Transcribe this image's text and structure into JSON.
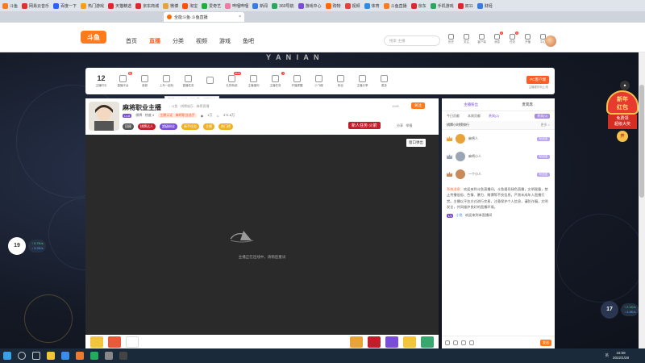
{
  "browser": {
    "bookmarks": [
      {
        "label": "斗鱼",
        "color": "#ff7a1a"
      },
      {
        "label": "网易云音乐",
        "color": "#e03030"
      },
      {
        "label": "百度一下",
        "color": "#2a62ff"
      },
      {
        "label": "热门游戏",
        "color": "#ff9a1a"
      },
      {
        "label": "天猫精选",
        "color": "#e0262e"
      },
      {
        "label": "京东商城",
        "color": "#e0262e"
      },
      {
        "label": "微博",
        "color": "#e8a23a"
      },
      {
        "label": "淘宝",
        "color": "#ff5000"
      },
      {
        "label": "爱奇艺",
        "color": "#1ab33a"
      },
      {
        "label": "哔哩哔哩",
        "color": "#f479a2"
      },
      {
        "label": "新闻",
        "color": "#3a7ae8"
      },
      {
        "label": "360导航",
        "color": "#26a85e"
      },
      {
        "label": "游戏中心",
        "color": "#7a4dd8"
      },
      {
        "label": "购物",
        "color": "#ff6a00"
      },
      {
        "label": "视频",
        "color": "#e8403a"
      },
      {
        "label": "体育",
        "color": "#2a8de8"
      },
      {
        "label": "斗鱼直播",
        "color": "#ff7a1a"
      },
      {
        "label": "京东",
        "color": "#e0262e"
      },
      {
        "label": "手机游戏",
        "color": "#26a85e"
      },
      {
        "label": "双11",
        "color": "#e0262e"
      },
      {
        "label": "财经",
        "color": "#3a7ae8"
      }
    ],
    "active_tab_title": "全能斗鱼·斗鱼直播",
    "url_hint": "https://www.douyu.com"
  },
  "nav": {
    "logo": "斗鱼",
    "links": [
      "首页",
      "直播",
      "分类",
      "视频",
      "游戏",
      "鱼吧"
    ],
    "active_link": "直播",
    "search_placeholder": "搜索·主播",
    "icons": [
      {
        "name": "history-icon",
        "label": "历史",
        "badge": ""
      },
      {
        "name": "follow-icon",
        "label": "关注",
        "badge": ""
      },
      {
        "name": "client-icon",
        "label": "客户端",
        "badge": ""
      },
      {
        "name": "message-icon",
        "label": "消息",
        "badge": "2"
      },
      {
        "name": "task-icon",
        "label": "任务",
        "badge": "1"
      },
      {
        "name": "live-icon",
        "label": "开播",
        "badge": ""
      },
      {
        "name": "center-icon",
        "label": "中心",
        "badge": ""
      }
    ]
  },
  "banner_text": "Y A N I A N",
  "catbar": {
    "count": "12",
    "count_label": "主播时长",
    "items": [
      {
        "label": "直播平台",
        "hot": "热"
      },
      {
        "label": "音频",
        "hot": ""
      },
      {
        "label": "上车一起玩",
        "hot": ""
      },
      {
        "label": "直播任务",
        "hot": ""
      },
      {
        "label": "",
        "hot": ""
      },
      {
        "label": "礼物系统",
        "hot": "NEW"
      },
      {
        "label": "主播福利",
        "hot": ""
      },
      {
        "label": "主播任务",
        "hot": "1"
      },
      {
        "label": "开播提醒",
        "hot": ""
      },
      {
        "label": "小飞碟",
        "hot": ""
      },
      {
        "label": "粉丝",
        "hot": ""
      },
      {
        "label": "主播分享",
        "hot": ""
      },
      {
        "label": "更多",
        "hot": ""
      }
    ],
    "pc_button": "PC客户端",
    "pc_sub": "主播更好玩上线",
    "tooltip": "不想上车出错 · 带大家一起玩游戏"
  },
  "room": {
    "title": "麻将职业主播",
    "meta": "· 斗鱼 · 棋牌娱乐 · 麻将直播",
    "room_id": "1108",
    "follow": "关注",
    "level": "Lv.8",
    "level_text": "棋牌 · 热度 4",
    "tag": "主播认证 · 麻将职业选手",
    "viewers": "1万",
    "hot": "371.6万",
    "pills": [
      {
        "label": "回顾",
        "color": "#555"
      },
      {
        "label": "棋牌达人",
        "color": "#c21d2b"
      },
      {
        "label": "超级粉丝",
        "color": "#7a4dd8"
      },
      {
        "label": "新手任务",
        "color": "#f0b020"
      },
      {
        "label": "主播",
        "color": "#f0b020"
      },
      {
        "label": "热门榜",
        "color": "#f0b020"
      }
    ],
    "new_task": "新人任务·火箭",
    "share": "分享",
    "report": "举报"
  },
  "player": {
    "fullscreen": "窗口弹出",
    "loading_text": "主播正在连线中，请稍后重试"
  },
  "chat": {
    "tabs": [
      "主播粉丝",
      "贵宾席"
    ],
    "subtabs": [
      "今日贡献",
      "本周贡献",
      "贵宾(2)"
    ],
    "subtab_right": "贵宾(0)",
    "hour_rank": "棋牌小时榜排行",
    "hour_rank_right": "更多 >",
    "ranks": [
      {
        "name": "麻将人",
        "tag": "粉丝团",
        "color": "#e8a23a"
      },
      {
        "name": "麻将小人",
        "tag": "粉丝团",
        "color": "#9aa5b5"
      },
      {
        "name": "一个小人",
        "tag": "粉丝团",
        "color": "#c98a5a"
      }
    ],
    "system_label": "系统消息：",
    "system_text": "欢迎来到斗鱼直播间，斗鱼倡导绿色直播，文明观看，禁止传播低俗、色情、暴力、赌博等不良信息。严禁未成年人直播打赏。主播以平台方式进行交易，注意保护个人信息，谨防诈骗，文明发言，共同维护良好的直播环境。",
    "welcome_user": "小鱼",
    "welcome_text": "欢迎来到本直播间",
    "send": "发送"
  },
  "floating": {
    "newyear_title": "新年\n红包",
    "newyear_sub": "免费领\n超级大奖",
    "newyear_btn": "开",
    "net_left": {
      "value": "19",
      "up": "0.7K/s",
      "down": "3.2K/s"
    },
    "net_right": {
      "value": "17",
      "up": "2.1K/s",
      "down": "4.8K/s"
    }
  },
  "taskbar": {
    "time": "16:09",
    "date": "2022/1/28",
    "lang": "英"
  }
}
